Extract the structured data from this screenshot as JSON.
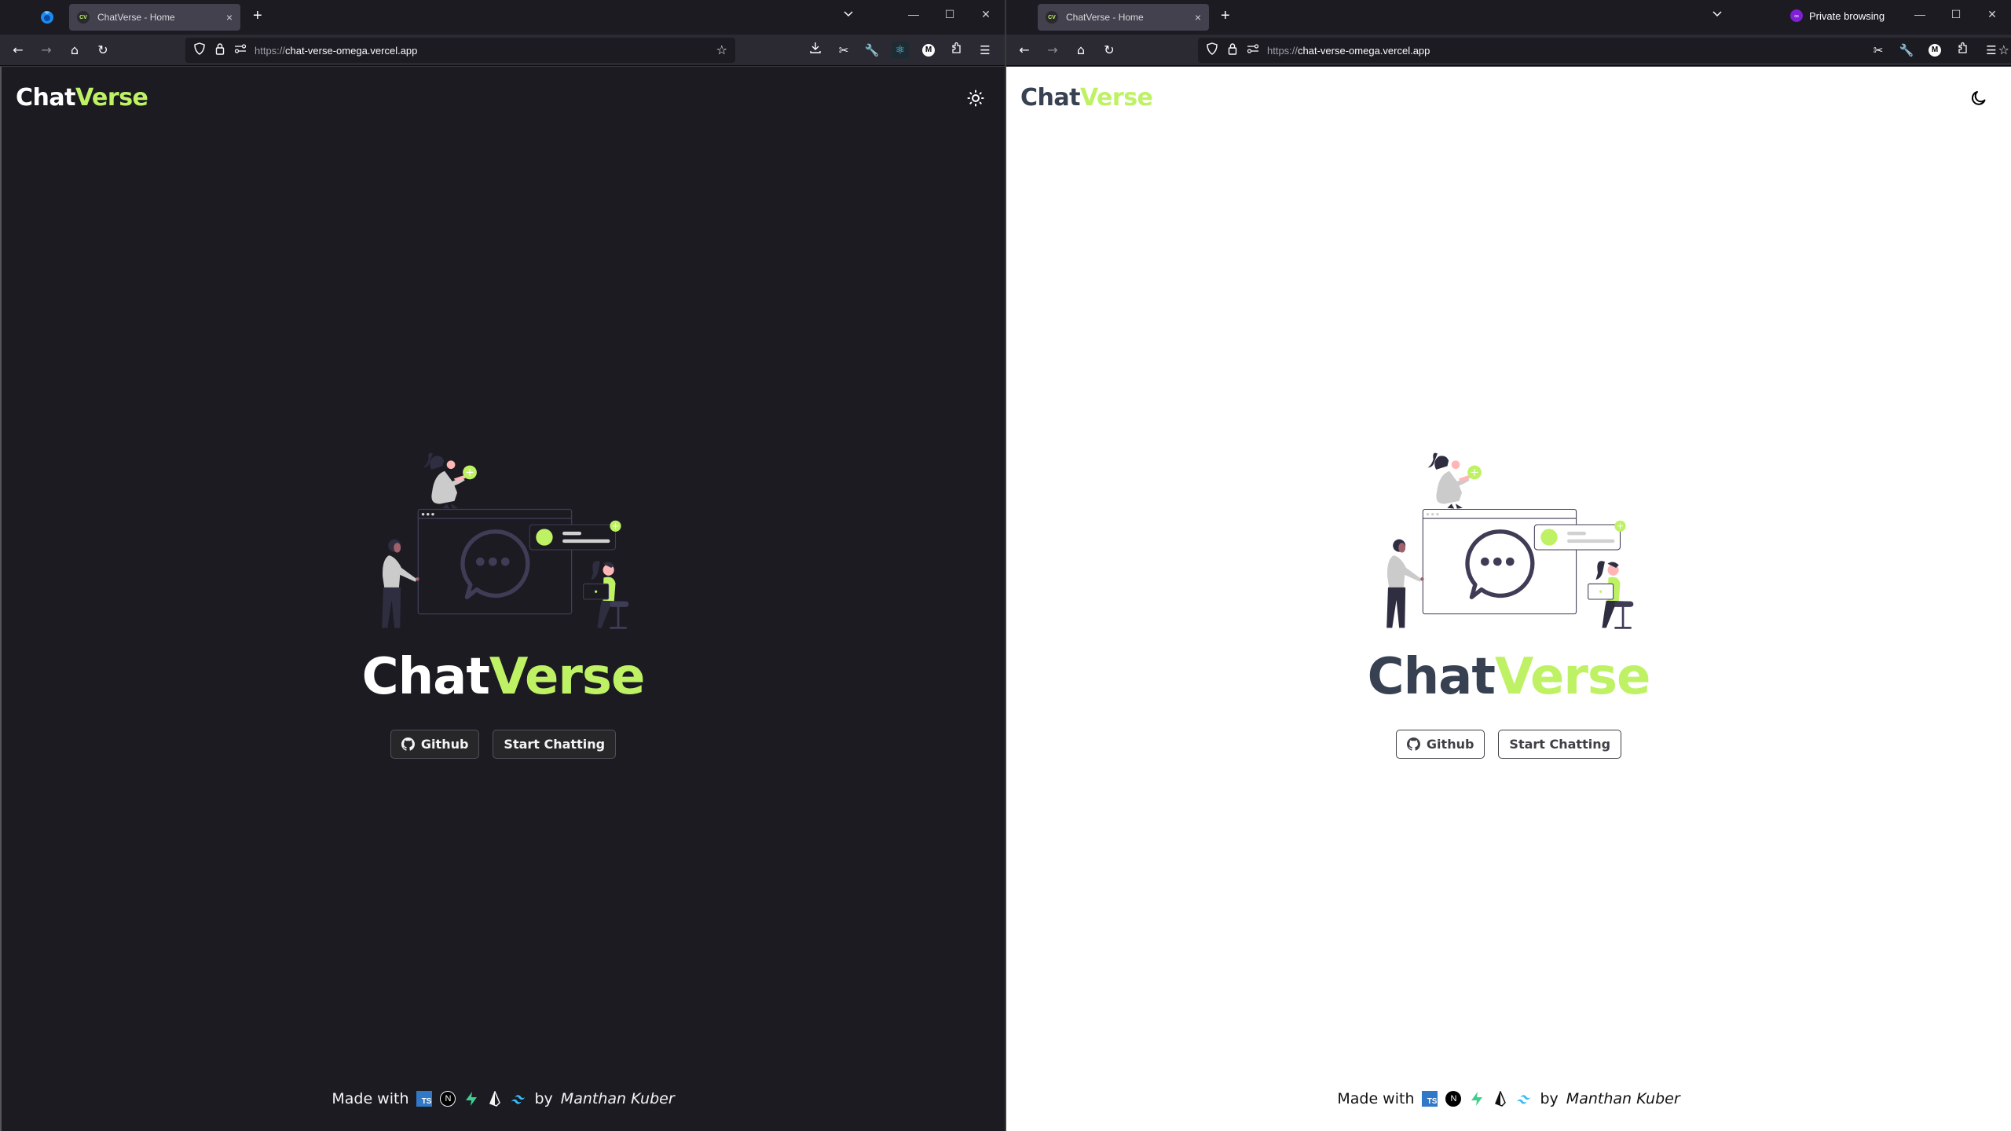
{
  "windows": [
    {
      "theme": "dark",
      "tab": {
        "favicon": "CV",
        "title": "ChatVerse - Home",
        "close": "×",
        "new_tab": "+"
      },
      "tab_list": "⌄",
      "private_label": null,
      "window_controls": {
        "minimize": "—",
        "maximize": "☐",
        "close": "✕"
      },
      "nav": {
        "back": "←",
        "forward": "→",
        "home": "⌂",
        "reload": "↻"
      },
      "url": {
        "scheme": "https://",
        "host": "chat-verse-omega.vercel.app"
      },
      "toolbar_icons": [
        "download-icon",
        "screenshot-icon",
        "wrench-icon",
        "react-devtools-icon",
        "m-extension-icon",
        "extensions-icon",
        "menu-icon"
      ],
      "page": {
        "logo": {
          "part1": "Chat",
          "part2": "Verse"
        },
        "theme_toggle_icon": "sun-icon",
        "hero": {
          "part1": "Chat",
          "part2": "Verse"
        },
        "buttons": {
          "github": "Github",
          "start": "Start Chatting"
        },
        "footer": {
          "made_with": "Made with",
          "by": "by",
          "author": "Manthan Kuber",
          "tech_icons": [
            "typescript-icon",
            "nextjs-icon",
            "supabase-icon",
            "prisma-icon",
            "tailwind-icon"
          ]
        }
      }
    },
    {
      "theme": "light",
      "tab": {
        "favicon": "CV",
        "title": "ChatVerse - Home",
        "close": "×",
        "new_tab": "+"
      },
      "tab_list": "⌄",
      "private_label": "Private browsing",
      "window_controls": {
        "minimize": "—",
        "maximize": "☐",
        "close": "✕"
      },
      "nav": {
        "back": "←",
        "forward": "→",
        "home": "⌂",
        "reload": "↻"
      },
      "url": {
        "scheme": "https://",
        "host": "chat-verse-omega.vercel.app"
      },
      "toolbar_icons": [
        "screenshot-icon",
        "wrench-icon",
        "m-extension-icon",
        "extensions-icon",
        "menu-icon"
      ],
      "page": {
        "logo": {
          "part1": "Chat",
          "part2": "Verse"
        },
        "theme_toggle_icon": "moon-icon",
        "hero": {
          "part1": "Chat",
          "part2": "Verse"
        },
        "buttons": {
          "github": "Github",
          "start": "Start Chatting"
        },
        "footer": {
          "made_with": "Made with",
          "by": "by",
          "author": "Manthan Kuber",
          "tech_icons": [
            "typescript-icon",
            "nextjs-icon",
            "supabase-icon",
            "prisma-icon",
            "tailwind-icon"
          ]
        }
      }
    }
  ],
  "colors": {
    "accent": "#bef264",
    "dark_bg": "#1c1b22",
    "light_bg": "#ffffff",
    "dark_text": "#374151",
    "private_purple": "#7f1fd6"
  }
}
